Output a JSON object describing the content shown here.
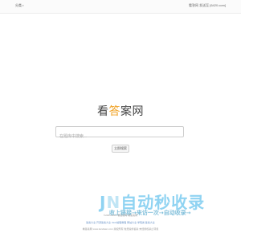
{
  "topbar": {
    "menu_label": "分类",
    "right_text": "看答网 发送至 [6420.com]"
  },
  "logo": {
    "part1": "看",
    "part2": "答",
    "part3": "案网"
  },
  "search": {
    "placeholder": "在题库中搜索..."
  },
  "search_button": {
    "label": "立即搜索"
  },
  "watermark": {
    "big_prefix": "J",
    "big_middle": "N",
    "big_suffix": "自动秒收录",
    "small": "收上链接→来访一次→自动收录→"
  },
  "footer": {
    "line1": "©2005-2021 看答案网   看答案网",
    "line2_links": [
      "答案大全",
      "开源答案大全",
      "Java编程教程",
      "网站大全",
      "学院类",
      "答案大全"
    ],
    "line3": "看答案网 www.kandaan.com 版权所有  免费提供答案 未经授权禁止转载"
  },
  "icons": {
    "menu_chevron": "chevron-down-icon"
  }
}
